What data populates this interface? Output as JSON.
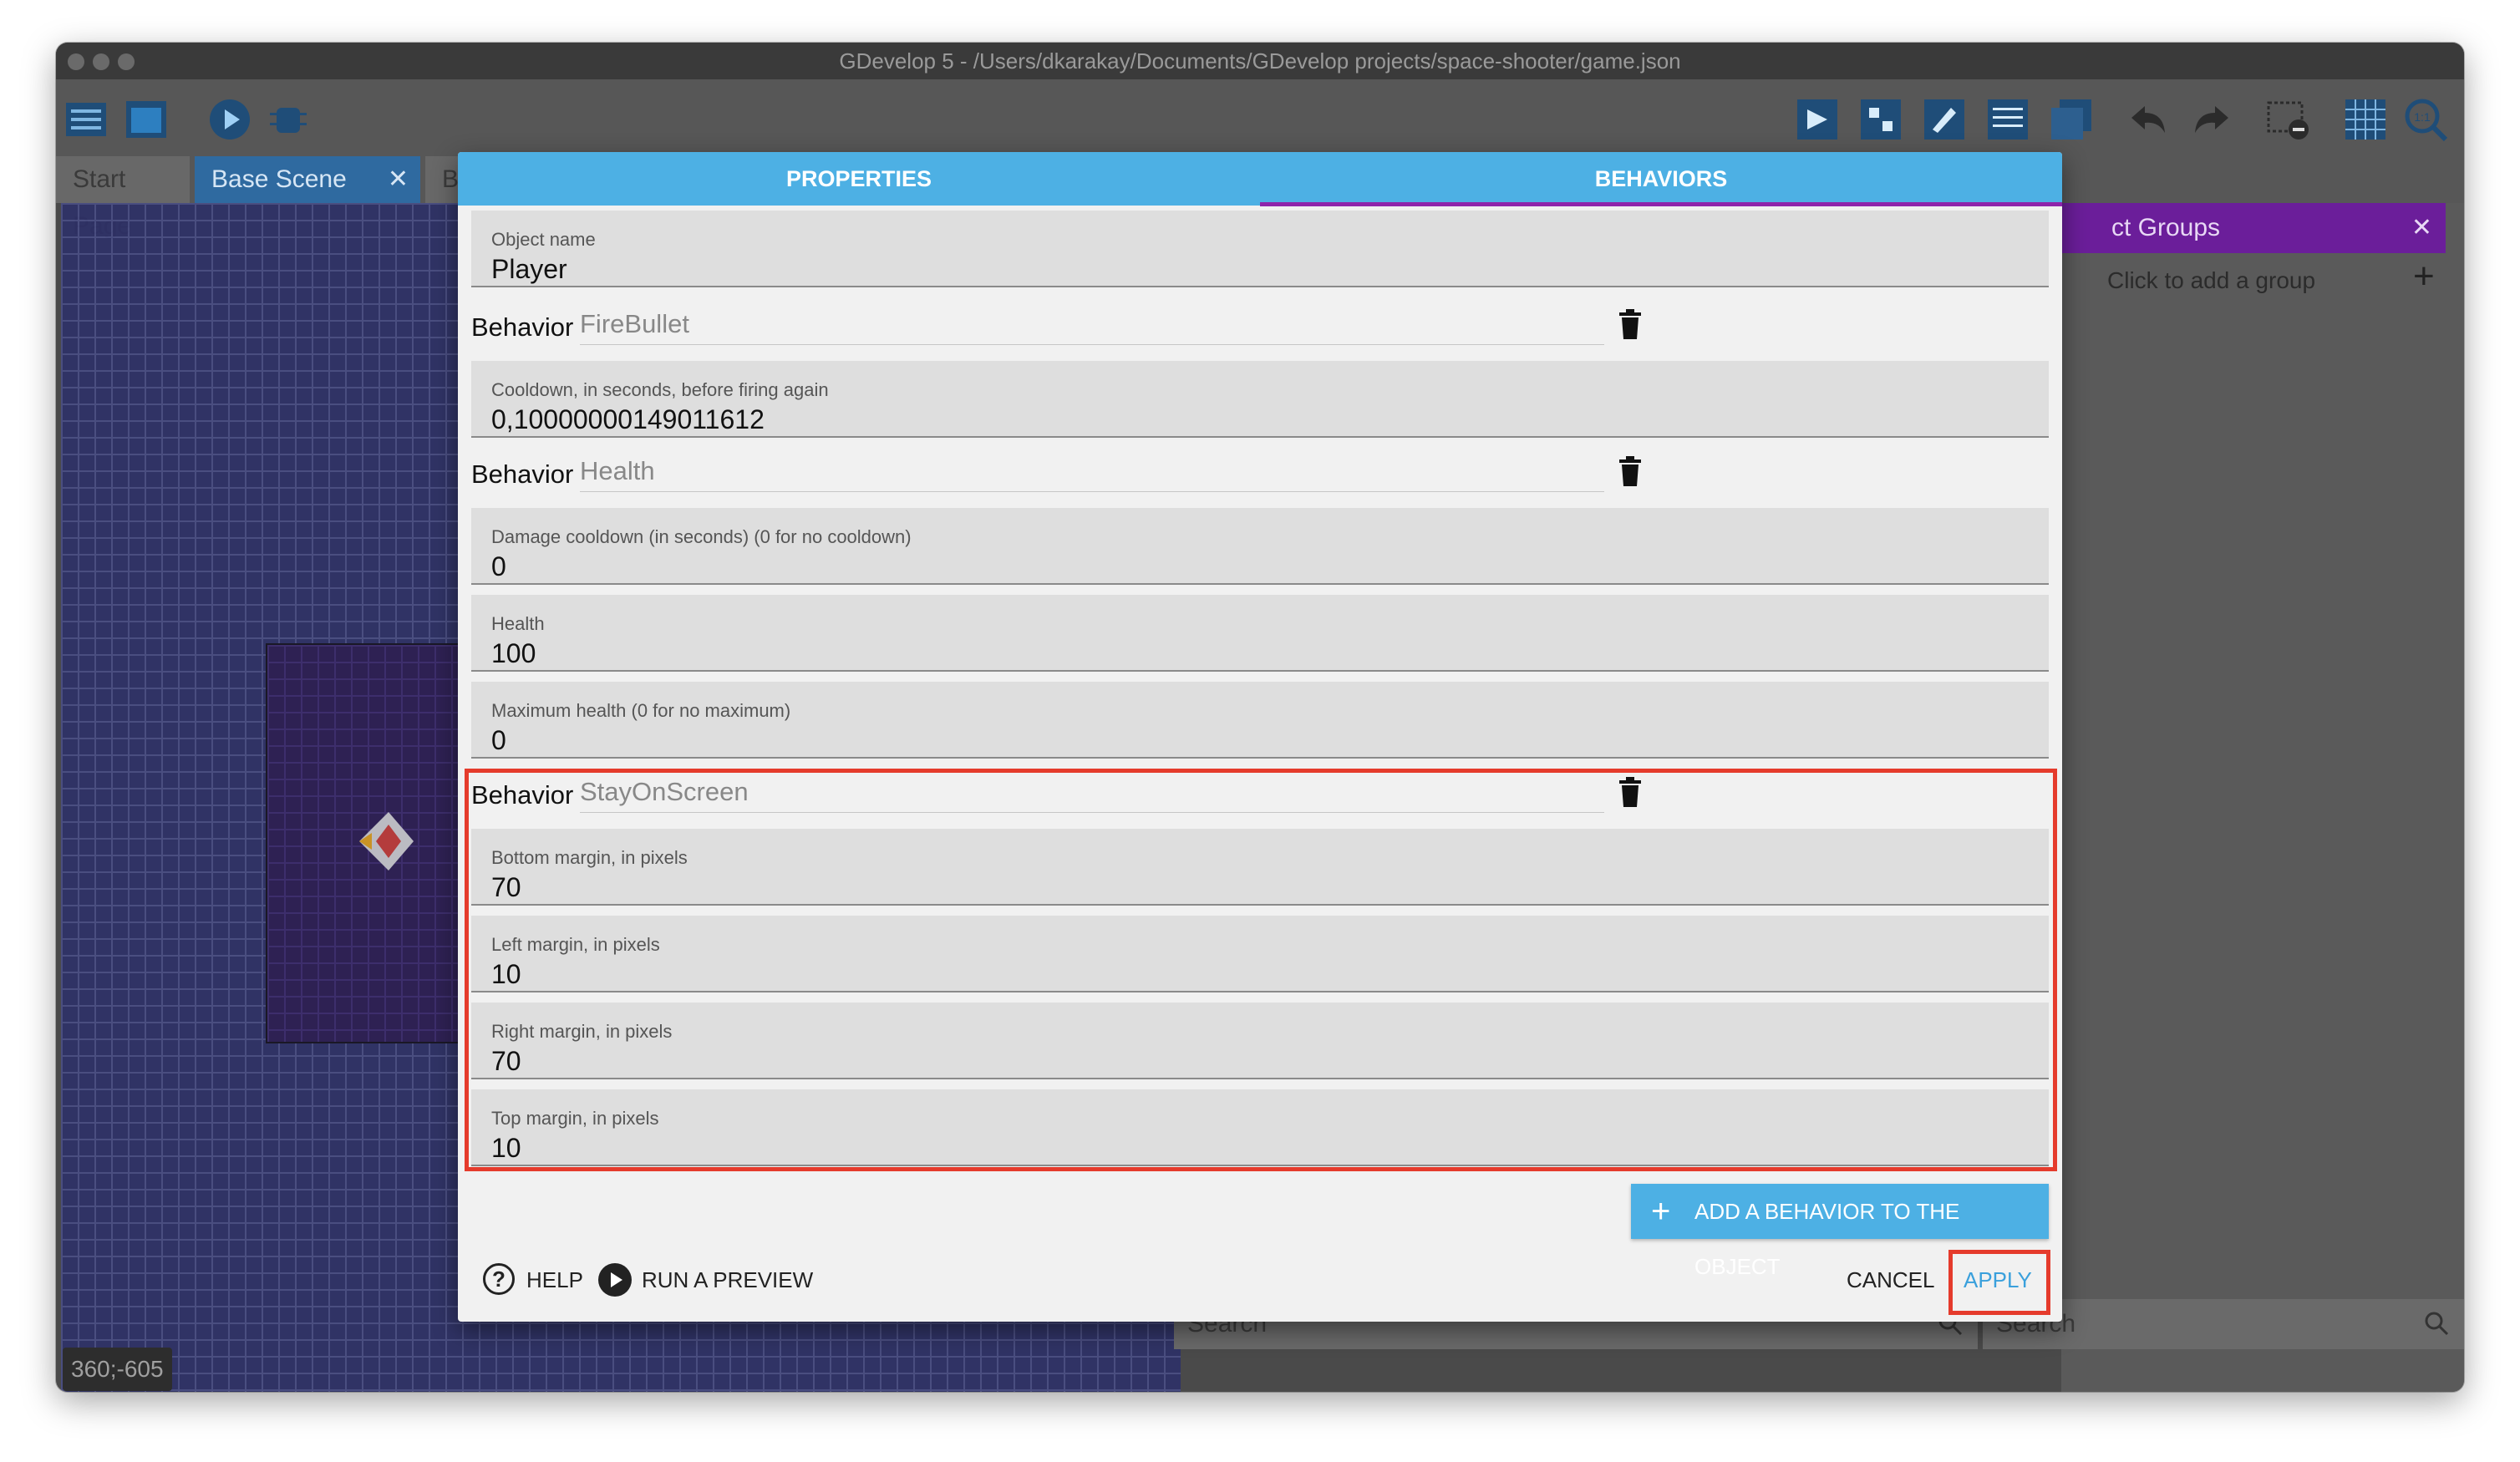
{
  "window": {
    "title": "GDevelop 5 - /Users/dkarakay/Documents/GDevelop projects/space-shooter/game.json"
  },
  "toolbar": {
    "left_icons": [
      "project-manager-icon",
      "scene-editor-icon",
      "preview-play-icon",
      "debugger-icon"
    ],
    "right_icons": [
      "object-editor-icon",
      "instances-icon",
      "properties-icon",
      "layers-icon",
      "layout-icon",
      "undo-icon",
      "redo-icon",
      "zoom-grid-icon",
      "grid-icon",
      "zoom-reset-icon"
    ]
  },
  "tabs": [
    {
      "label": "Start Page",
      "active": false
    },
    {
      "label": "Base Scene",
      "active": true,
      "close": "✕"
    },
    {
      "label": "Ba",
      "active": false
    }
  ],
  "canvas": {
    "coordinates": "360;-605"
  },
  "groups_panel": {
    "title": "ct Groups",
    "close": "✕",
    "add_group_text": "Click to add a group",
    "add_symbol": "+"
  },
  "bottom_search": {
    "left_placeholder": "Search",
    "right_placeholder": "Search"
  },
  "dialog": {
    "tabs": [
      {
        "label": "PROPERTIES",
        "active": false
      },
      {
        "label": "BEHAVIORS",
        "active": true
      }
    ],
    "object_name": {
      "label": "Object name",
      "value": "Player"
    },
    "behaviors": [
      {
        "prefix": "Behavior",
        "name": "FireBullet",
        "fields": [
          {
            "label": "Cooldown, in seconds, before firing again",
            "value": "0,10000000149011612"
          }
        ]
      },
      {
        "prefix": "Behavior",
        "name": "Health",
        "fields": [
          {
            "label": "Damage cooldown (in seconds) (0 for no cooldown)",
            "value": "0"
          },
          {
            "label": "Health",
            "value": "100"
          },
          {
            "label": "Maximum health (0 for no maximum)",
            "value": "0"
          }
        ]
      },
      {
        "prefix": "Behavior",
        "name": "StayOnScreen",
        "fields": [
          {
            "label": "Bottom margin, in pixels",
            "value": "70"
          },
          {
            "label": "Left margin, in pixels",
            "value": "10"
          },
          {
            "label": "Right margin, in pixels",
            "value": "70"
          },
          {
            "label": "Top margin, in pixels",
            "value": "10"
          }
        ]
      }
    ],
    "add_behavior": {
      "plus": "+",
      "label": "ADD A BEHAVIOR TO THE OBJECT"
    },
    "footer": {
      "help_symbol": "?",
      "help_label": "HELP",
      "preview_label": "RUN A PREVIEW",
      "cancel_label": "CANCEL",
      "apply_label": "APPLY"
    }
  },
  "colors": {
    "dialog_tab_bar": "#4db0e4",
    "active_tab_underline": "#8e24aa",
    "highlight": "#e53b2c",
    "apply_text": "#3aa0dc",
    "groups_header": "#6b1e9a"
  }
}
